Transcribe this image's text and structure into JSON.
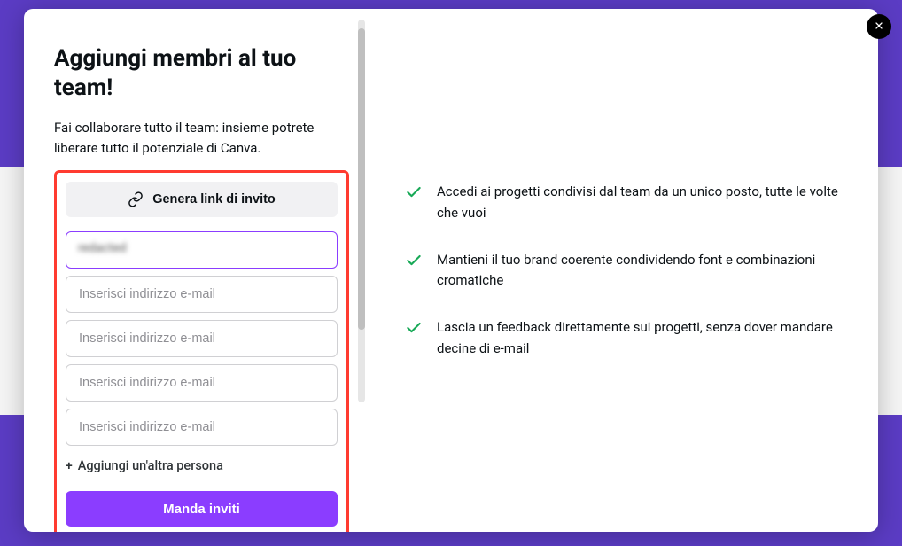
{
  "modal": {
    "title": "Aggiungi membri al tuo team!",
    "subtitle": "Fai collaborare tutto il team: insieme potrete liberare tutto il potenziale di Canva.",
    "generate_link_label": "Genera link di invito",
    "emails": {
      "active_value": "redacted",
      "placeholder": "Inserisci indirizzo e-mail"
    },
    "add_another_label": "Aggiungi un'altra persona",
    "send_button_label": "Manda inviti",
    "benefits": [
      "Accedi ai progetti condivisi dal team da un unico posto, tutte le volte che vuoi",
      "Mantieni il tuo brand coerente condividendo font e combinazioni cromatiche",
      "Lascia un feedback direttamente sui progetti, senza dover mandare decine di e-mail"
    ]
  }
}
